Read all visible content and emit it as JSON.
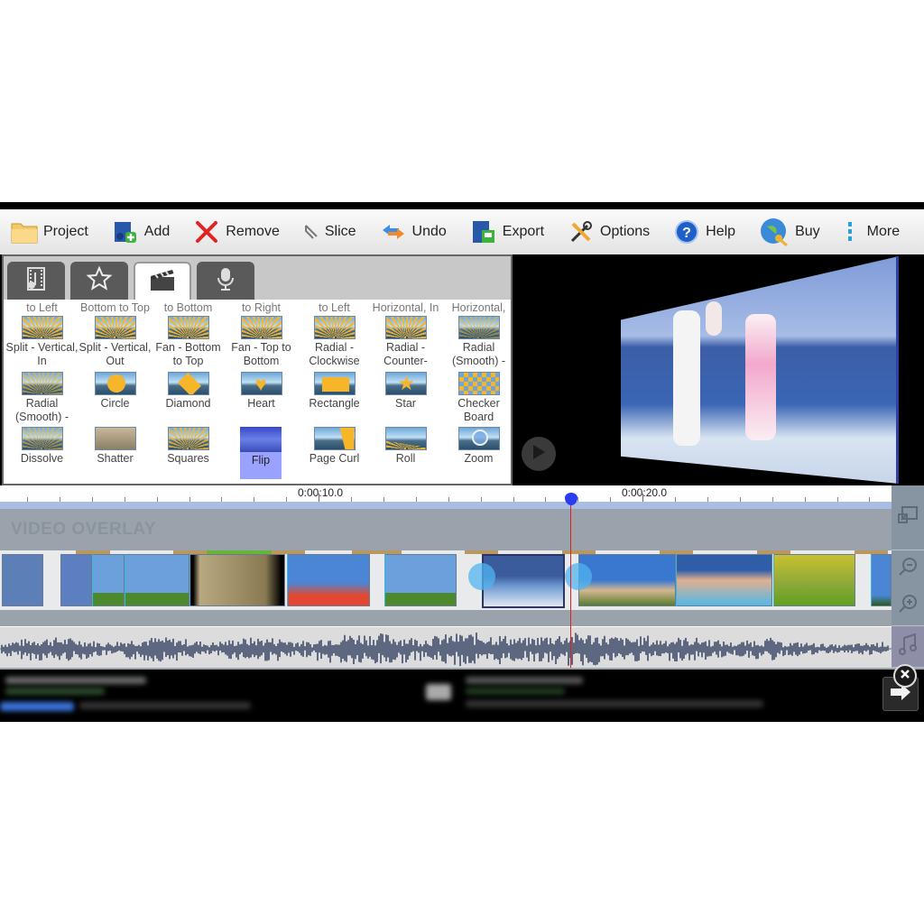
{
  "toolbar": {
    "items": [
      {
        "label": "Project",
        "icon": "folder-icon"
      },
      {
        "label": "Add",
        "icon": "add-media-icon"
      },
      {
        "label": "Remove",
        "icon": "remove-x-icon"
      },
      {
        "label": "Slice",
        "icon": "slice-icon"
      },
      {
        "label": "Undo",
        "icon": "undo-arrows-icon"
      },
      {
        "label": "Export",
        "icon": "export-icon"
      },
      {
        "label": "Options",
        "icon": "tools-icon"
      },
      {
        "label": "Help",
        "icon": "help-icon"
      },
      {
        "label": "Buy",
        "icon": "globe-key-icon"
      },
      {
        "label": "More",
        "icon": "more-vertical-icon"
      }
    ]
  },
  "panel": {
    "tabs": [
      {
        "name": "media-tab",
        "icon": "film-music-icon",
        "active": false
      },
      {
        "name": "effects-tab",
        "icon": "star-icon",
        "active": false
      },
      {
        "name": "transitions-tab",
        "icon": "clapperboard-icon",
        "active": true
      },
      {
        "name": "audio-tab",
        "icon": "microphone-icon",
        "active": false
      }
    ],
    "partial_row": [
      "to Left",
      "Bottom to Top",
      "to Bottom",
      "to Right",
      "to Left",
      "Horizontal, In",
      "Horizontal,"
    ],
    "transitions": [
      [
        "Split - Vertical, In",
        "Split - Vertical, Out",
        "Fan - Bottom to Top",
        "Fan - Top to Bottom",
        "Radial - Clockwise",
        "Radial - Counter-",
        "Radial (Smooth) -"
      ],
      [
        "Radial (Smooth) -",
        "Circle",
        "Diamond",
        "Heart",
        "Rectangle",
        "Star",
        "Checker Board"
      ],
      [
        "Dissolve",
        "Shatter",
        "Squares",
        "Flip",
        "Page Curl",
        "Roll",
        "Zoom"
      ]
    ],
    "selected": "Flip"
  },
  "preview": {
    "play_icon": "play-icon"
  },
  "timeline": {
    "time_labels": [
      "0:00:10.0",
      "0:00:20.0"
    ],
    "playhead_time_seconds": 17.9,
    "overlay_track_label": "VIDEO OVERLAY",
    "side_tools": [
      {
        "name": "overlay-add-button",
        "icon": "overlay-icon"
      },
      {
        "name": "zoom-out-button",
        "icon": "zoom-out-icon"
      },
      {
        "name": "zoom-in-button",
        "icon": "zoom-in-icon"
      },
      {
        "name": "music-button",
        "icon": "music-note-icon"
      }
    ],
    "clips": [
      {
        "desc": "boys on beach",
        "color": "#5d7fb8"
      },
      {
        "desc": "boys on beach",
        "color": "#5b7fc0"
      },
      {
        "desc": "jumping family sky",
        "color": "#6aa0dc"
      },
      {
        "desc": "jumping family sky",
        "color": "#6aa0dc"
      },
      {
        "desc": "sepia child with dog",
        "color": "#8a7a52"
      },
      {
        "desc": "girls with pinwheel",
        "color": "#4a86d4"
      },
      {
        "desc": "jumping family sky",
        "color": "#6aa0dc"
      },
      {
        "desc": "family in surf",
        "color": "#3a5c9c"
      },
      {
        "desc": "father lifting baby",
        "color": "#3a78d0"
      },
      {
        "desc": "group of kids",
        "color": "#2e5ea8"
      },
      {
        "desc": "family on grass",
        "color": "#8aa838"
      },
      {
        "desc": "girls with pinwheel",
        "color": "#4a86d4"
      }
    ]
  },
  "ad": {
    "close_icon": "close-icon",
    "next_icon": "arrow-right-icon"
  }
}
